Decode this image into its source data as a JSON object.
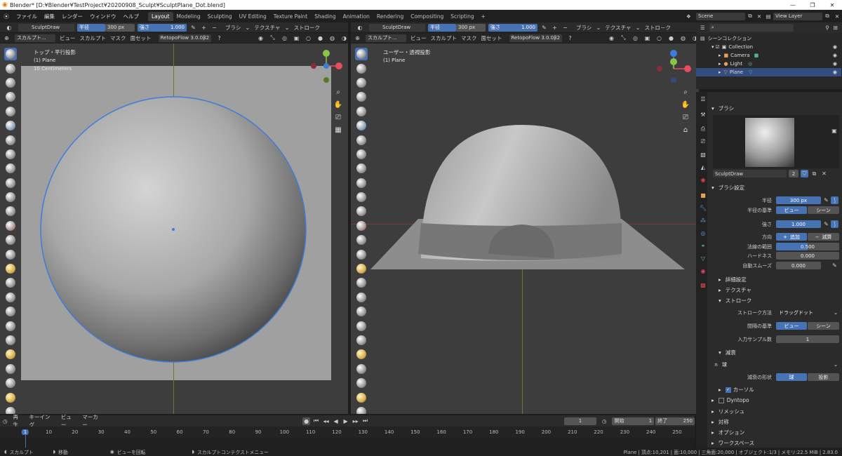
{
  "window": {
    "title": "Blender* [D:¥Blender¥TestProject¥20200908_Sculpt¥SculptPlane_Dot.blend]",
    "min": "—",
    "max": "❐",
    "close": "✕"
  },
  "menus": [
    "ファイル",
    "編集",
    "レンダー",
    "ウィンドウ",
    "ヘルプ"
  ],
  "workspaces": [
    "Layout",
    "Modeling",
    "Sculpting",
    "UV Editing",
    "Texture Paint",
    "Shading",
    "Animation",
    "Rendering",
    "Compositing",
    "Scripting",
    "+"
  ],
  "scene": {
    "label": "Scene",
    "view_layer": "View Layer"
  },
  "tool_header": {
    "brush_name": "SculptDraw",
    "radius_label": "半径",
    "radius_value": "300 px",
    "strength_label": "強さ",
    "strength_value": "1.000",
    "brush_menu": "ブラシ",
    "texture_menu": "テクスチャ",
    "stroke_menu": "ストローク",
    "stroke_menu_cut": "ストロ－ク"
  },
  "view_header": {
    "mode": "スカルプト...",
    "menus": [
      "ビュー",
      "スカルプト",
      "マスク",
      "面セット"
    ],
    "addon": "RetopoFlow 3.0.0β2"
  },
  "left_view": {
    "title": "トップ・平行投影",
    "object": "(1) Plane",
    "scale": "10 Centimeters"
  },
  "right_view": {
    "title": "ユーザー・透視投影",
    "object": "(1) Plane"
  },
  "outliner": {
    "title": "シーンコレクション",
    "items": [
      {
        "label": "Collection"
      },
      {
        "label": "Camera"
      },
      {
        "label": "Light"
      },
      {
        "label": "Plane"
      }
    ]
  },
  "props": {
    "brush_section": "ブラシ",
    "brush_name": "SculptDraw",
    "brush_users": "2",
    "brush_settings": "ブラシ設定",
    "radius_label": "半径",
    "radius_value": "300 px",
    "radius_base_label": "半径の基準",
    "view_opt": "ビュー",
    "scene_opt": "シーン",
    "strength_label": "強さ",
    "strength_value": "1.000",
    "direction_label": "方向",
    "add_opt": "追加",
    "sub_opt": "減算",
    "normal_radius_label": "法線の範囲",
    "normal_radius_value": "0.500",
    "hardness_label": "ハードネス",
    "hardness_value": "0.000",
    "autosmooth_label": "自動スムーズ",
    "autosmooth_value": "0.000",
    "advanced": "詳細設定",
    "texture": "テクスチャ",
    "stroke": "ストローク",
    "stroke_method_label": "ストローク方法",
    "stroke_method_value": "ドラッグドット",
    "spacing_label": "間隔の基準",
    "spacing_view": "ビュー",
    "spacing_scene": "シーン",
    "input_samples_label": "入力サンプル数",
    "input_samples_value": "1",
    "falloff": "減衰",
    "falloff_preset": "球",
    "falloff_shape_label": "減衰の形状",
    "falloff_sphere": "球",
    "falloff_projected": "投影",
    "cursor": "カーソル",
    "dyntopo": "Dyntopo",
    "remesh": "リメッシュ",
    "symmetry": "対称",
    "options": "オプション",
    "workspace": "ワークスペース"
  },
  "timeline": {
    "menus": [
      "再生",
      "キーイング",
      "ビュー",
      "マーカー"
    ],
    "current_frame": "1",
    "start_label": "開始",
    "start": "1",
    "end_label": "終了",
    "end": "250",
    "ticks": [
      "1",
      "10",
      "20",
      "30",
      "40",
      "50",
      "60",
      "70",
      "80",
      "90",
      "100",
      "110",
      "120",
      "130",
      "140",
      "150",
      "160",
      "170",
      "180",
      "190",
      "200",
      "210",
      "220",
      "230",
      "240",
      "250"
    ]
  },
  "status": {
    "left1": "スカルプト",
    "left2": "移動",
    "mid1": "ビューを回転",
    "mid2": "スカルプトコンテクストメニュー",
    "right": "Plane | 頂点:10,201 | 面:10,000 | 三角面:20,000 | オブジェクト:1/3 | メモリ:22.5 MiB | 2.83.0"
  },
  "colors": {
    "accent": "#4772b3",
    "viewport_bg": "#3d3d3d",
    "panel_bg": "#2b2b2b",
    "x_axis": "#e84a5f",
    "y_axis": "#8bc34a",
    "z_axis": "#3d7dd8"
  }
}
